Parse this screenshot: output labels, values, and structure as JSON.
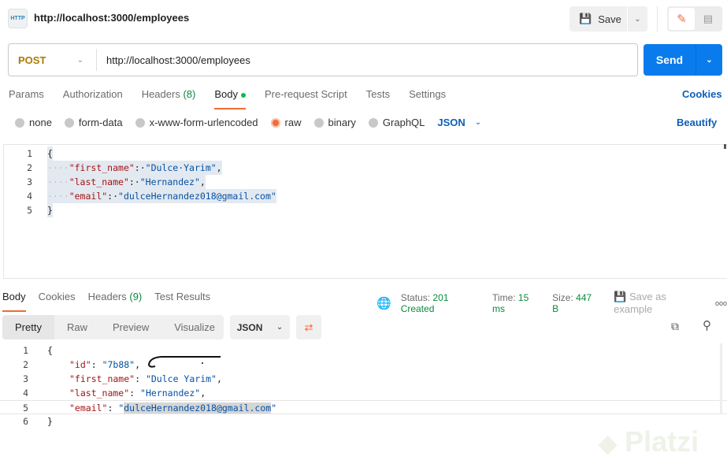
{
  "header": {
    "title": "http://localhost:3000/employees",
    "icon_text": "HTTP",
    "save_label": "Save"
  },
  "request": {
    "method": "POST",
    "url": "http://localhost:3000/employees",
    "send_label": "Send"
  },
  "tabs": [
    {
      "label": "Params"
    },
    {
      "label": "Authorization"
    },
    {
      "label": "Headers",
      "count": "(8)"
    },
    {
      "label": "Body"
    },
    {
      "label": "Pre-request Script"
    },
    {
      "label": "Tests"
    },
    {
      "label": "Settings"
    }
  ],
  "cookies_label": "Cookies",
  "body_options": [
    "none",
    "form-data",
    "x-www-form-urlencoded",
    "raw",
    "binary",
    "GraphQL"
  ],
  "body_selected": "raw",
  "body_format": "JSON",
  "beautify_label": "Beautify",
  "request_body": [
    {
      "n": "1",
      "indent": "",
      "key": "",
      "val": "",
      "punct": "{"
    },
    {
      "n": "2",
      "indent": "····",
      "key": "\"first_name\"",
      "val": "\"Dulce·Yarim\"",
      "punct": ","
    },
    {
      "n": "3",
      "indent": "····",
      "key": "\"last_name\"",
      "val": "\"Hernandez\"",
      "punct": ","
    },
    {
      "n": "4",
      "indent": "····",
      "key": "\"email\"",
      "val": "\"dulceHernandez018@gmail.com\"",
      "punct": ""
    },
    {
      "n": "5",
      "indent": "",
      "key": "",
      "val": "",
      "punct": "}"
    }
  ],
  "response": {
    "tabs": [
      {
        "label": "Body"
      },
      {
        "label": "Cookies"
      },
      {
        "label": "Headers",
        "count": "(9)"
      },
      {
        "label": "Test Results"
      }
    ],
    "status_label": "Status:",
    "status": "201 Created",
    "time_label": "Time:",
    "time": "15 ms",
    "size_label": "Size:",
    "size": "447 B",
    "save_example": "Save as example",
    "more": "ooo",
    "view_tabs": [
      "Pretty",
      "Raw",
      "Preview",
      "Visualize"
    ],
    "format": "JSON",
    "lines": [
      {
        "n": "1",
        "key": "",
        "val": "",
        "punct": "{"
      },
      {
        "n": "2",
        "key": "\"id\"",
        "val": "\"7b88\"",
        "punct": ","
      },
      {
        "n": "3",
        "key": "\"first_name\"",
        "val": "\"Dulce Yarim\"",
        "punct": ","
      },
      {
        "n": "4",
        "key": "\"last_name\"",
        "val": "\"Hernandez\"",
        "punct": ","
      },
      {
        "n": "5",
        "key": "\"email\"",
        "val": "\"dulceHernandez018@gmail.com\"",
        "punct": ""
      },
      {
        "n": "6",
        "key": "",
        "val": "",
        "punct": "}"
      }
    ]
  },
  "watermark": "Platzi",
  "colors": {
    "accent": "#097bed",
    "method": "#ad7a03",
    "active_tab": "#f26b3a",
    "status": "#0b8a3f"
  }
}
